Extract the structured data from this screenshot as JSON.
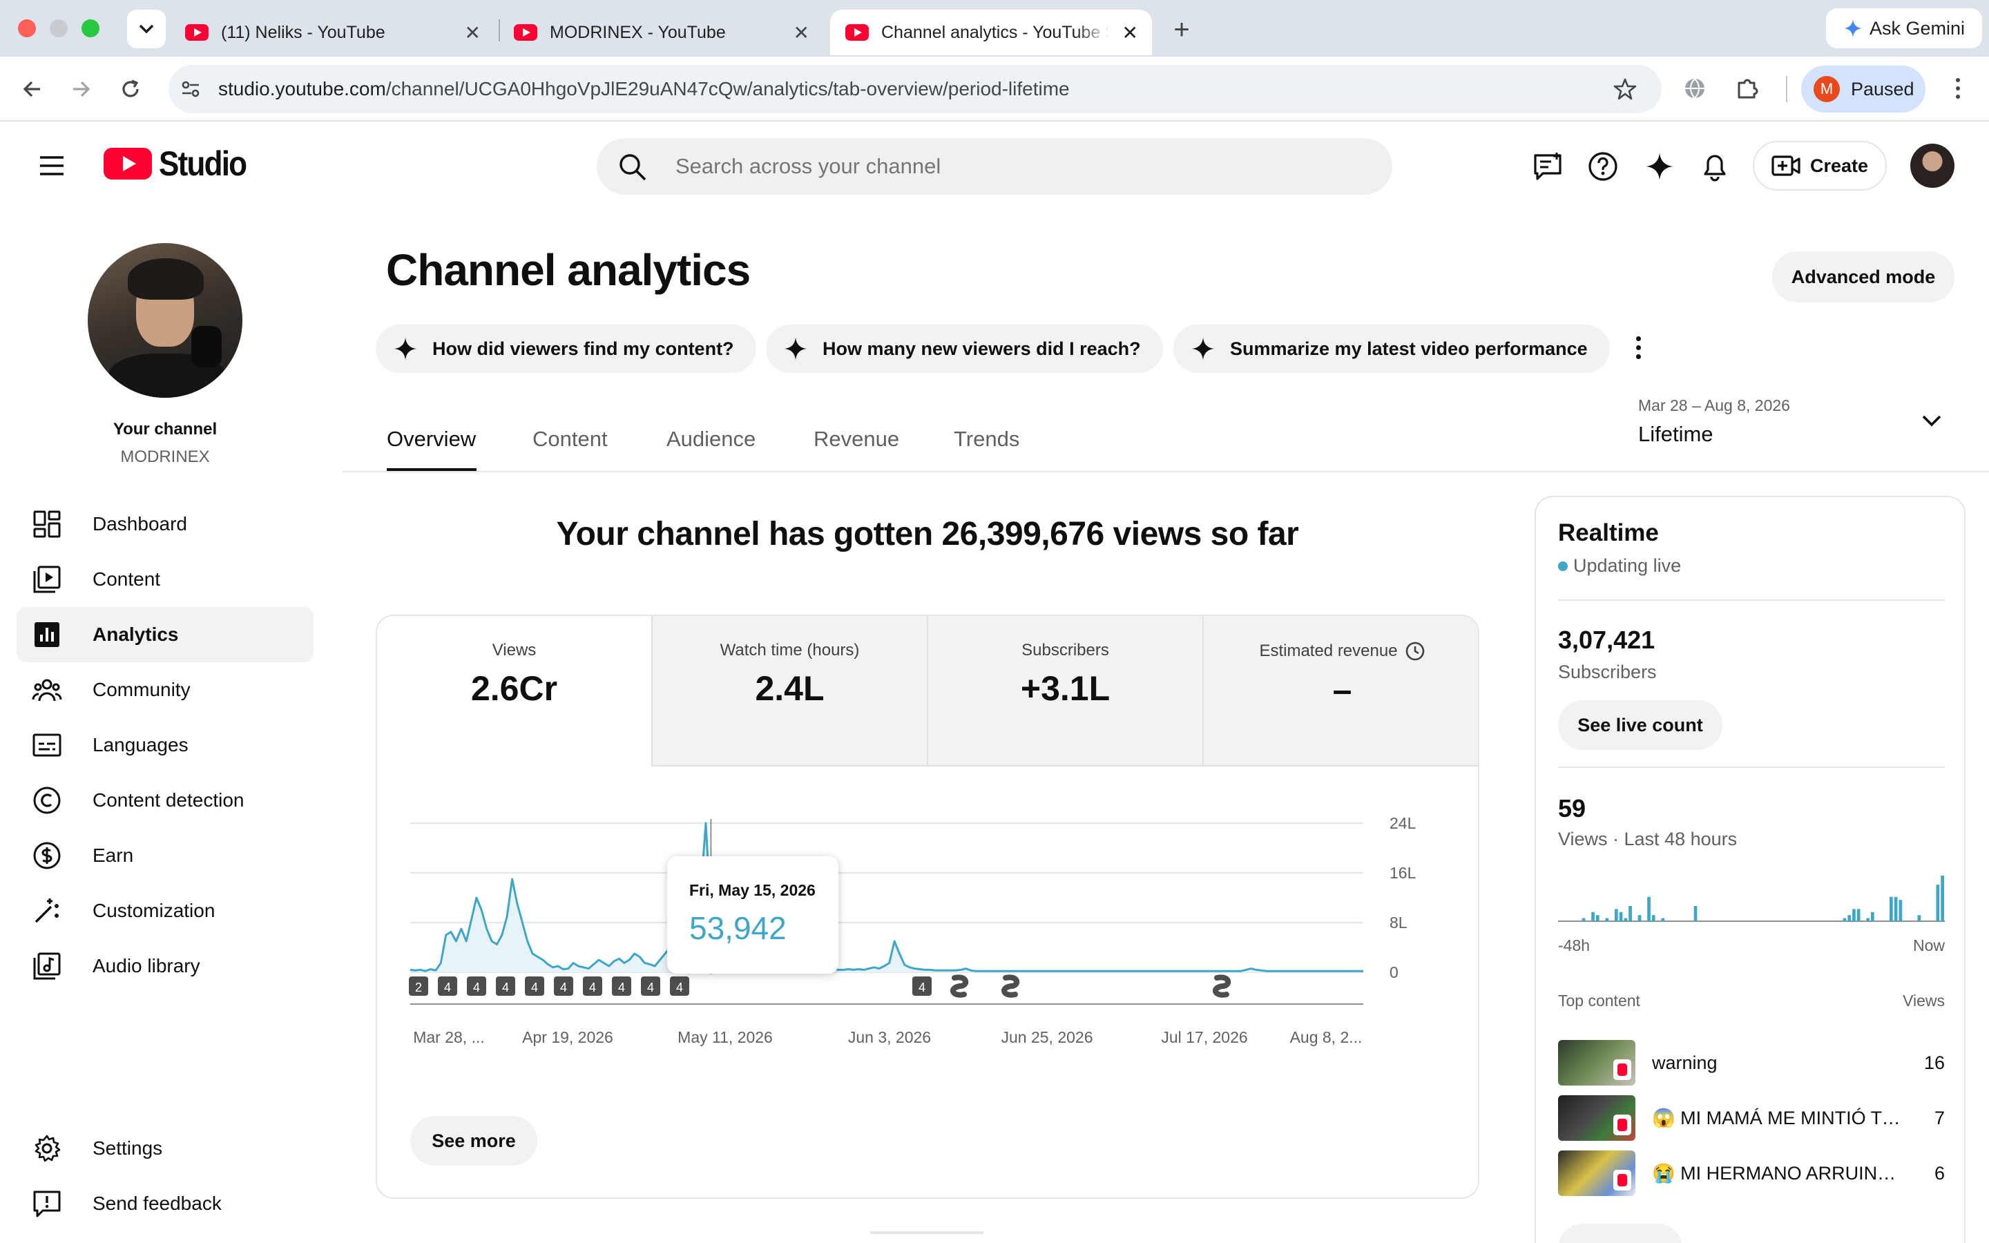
{
  "browser": {
    "tabs": [
      {
        "title": "(11) Neliks - YouTube"
      },
      {
        "title": "MODRINEX - YouTube"
      },
      {
        "title": "Channel analytics - YouTube Studio"
      }
    ],
    "url_domain": "studio.youtube.com",
    "url_path": "/channel/UCGA0HhgoVpJlE29uAN47cQw/analytics/tab-overview/period-lifetime",
    "profile_initial": "M",
    "profile_status": "Paused",
    "ask_gemini": "Ask Gemini"
  },
  "header": {
    "logo_text": "Studio",
    "search_placeholder": "Search across your channel",
    "create_label": "Create"
  },
  "sidebar": {
    "your_channel": "Your channel",
    "channel_name": "MODRINEX",
    "items": [
      {
        "label": "Dashboard",
        "icon": "dashboard-icon"
      },
      {
        "label": "Content",
        "icon": "content-icon"
      },
      {
        "label": "Analytics",
        "icon": "analytics-icon"
      },
      {
        "label": "Community",
        "icon": "community-icon"
      },
      {
        "label": "Languages",
        "icon": "languages-icon"
      },
      {
        "label": "Content detection",
        "icon": "copyright-icon"
      },
      {
        "label": "Earn",
        "icon": "earn-icon"
      },
      {
        "label": "Customization",
        "icon": "magic-wand-icon"
      },
      {
        "label": "Audio library",
        "icon": "audio-library-icon"
      }
    ],
    "settings": "Settings",
    "send_feedback": "Send feedback"
  },
  "page": {
    "title": "Channel analytics",
    "advanced_mode": "Advanced mode",
    "chips": [
      "How did viewers find my content?",
      "How many new viewers did I reach?",
      "Summarize my latest video performance"
    ],
    "tabs": [
      "Overview",
      "Content",
      "Audience",
      "Revenue",
      "Trends"
    ],
    "date_range": "Mar 28 – Aug 8, 2026",
    "period": "Lifetime",
    "headline": "Your channel has gotten 26,399,676 views so far"
  },
  "metrics": [
    {
      "label": "Views",
      "value": "2.6Cr"
    },
    {
      "label": "Watch time (hours)",
      "value": "2.4L"
    },
    {
      "label": "Subscribers",
      "value": "+3.1L"
    },
    {
      "label": "Estimated revenue",
      "value": "–"
    }
  ],
  "chart_data": {
    "type": "area",
    "y_tick_labels": [
      "24L",
      "16L",
      "8L",
      "0"
    ],
    "x_tick_labels": [
      "Mar 28, ...",
      "Apr 19, 2026",
      "May 11, 2026",
      "Jun 3, 2026",
      "Jun 25, 2026",
      "Jul 17, 2026",
      "Aug 8, 2..."
    ],
    "series": [
      {
        "values_lakh": [
          0.4,
          0.3,
          0.4,
          0.2,
          0.5,
          0.3,
          1.5,
          6,
          6.5,
          5,
          7,
          5,
          8.5,
          12,
          10,
          7,
          5,
          4.5,
          6,
          9,
          15,
          11,
          8,
          5,
          3,
          2.5,
          2,
          1.3,
          0.8,
          1,
          0.5,
          0.6,
          1.5,
          1,
          0.8,
          0.6,
          1.3,
          2,
          1.5,
          1,
          1.8,
          2.2,
          1.5,
          2,
          3,
          2.5,
          1.5,
          1.3,
          1,
          2,
          3,
          4,
          5,
          4.5,
          5,
          7,
          8,
          13,
          24,
          9,
          6,
          3,
          2,
          1,
          0.8,
          0.8,
          1,
          0.5,
          0.5,
          0.6,
          0.5,
          0.4,
          0.4,
          0.4,
          0.5,
          0.4,
          0.4,
          0.5,
          0.6,
          0.4,
          0.4,
          0.4,
          0.4,
          0.5,
          0.4,
          0.4,
          0.5,
          0.4,
          0.5,
          0.4,
          0.6,
          0.8,
          0.6,
          1,
          1.5,
          5,
          3,
          1.2,
          0.8,
          0.6,
          0.5,
          0.4,
          0.4,
          0.3,
          0.3,
          0.3,
          0.3,
          0.3,
          0.4,
          0.6,
          0.3,
          0.2,
          0.2,
          0.2,
          0.2,
          0.2,
          0.2,
          0.2,
          0.2,
          0.2,
          0.2,
          0.2,
          0.2,
          0.2,
          0.2,
          0.2,
          0.2,
          0.2,
          0.2,
          0.2,
          0.2,
          0.2,
          0.2,
          0.2,
          0.2,
          0.2,
          0.2,
          0.2,
          0.2,
          0.2,
          0.2,
          0.2,
          0.2,
          0.2,
          0.2,
          0.2,
          0.2,
          0.2,
          0.2,
          0.2,
          0.2,
          0.2,
          0.2,
          0.2,
          0.2,
          0.2,
          0.2,
          0.2,
          0.2,
          0.2,
          0.2,
          0.2,
          0.2,
          0.2,
          0.4,
          0.6,
          0.4,
          0.3,
          0.2,
          0.2,
          0.2,
          0.2,
          0.2,
          0.2,
          0.2,
          0.2,
          0.2,
          0.2,
          0.2,
          0.2,
          0.2,
          0.2,
          0.2,
          0.2,
          0.2,
          0.2,
          0.2,
          0.2
        ]
      }
    ],
    "ylim_lakh": [
      0,
      24
    ],
    "tooltip": {
      "date": "Fri, May 15, 2026",
      "value": "53,942"
    },
    "publish_markers": [
      "2",
      "4",
      "4",
      "4",
      "4",
      "4",
      "4",
      "4",
      "4",
      "4",
      "4"
    ],
    "see_more": "See more"
  },
  "realtime": {
    "title": "Realtime",
    "status": "Updating live",
    "subscribers_value": "3,07,421",
    "subscribers_label": "Subscribers",
    "see_live_count": "See live count",
    "views_value": "59",
    "views_label": "Views · Last 48 hours",
    "bars": [
      0,
      0,
      0,
      0,
      0,
      1,
      0,
      3,
      2,
      0,
      1,
      0,
      4,
      3,
      1,
      5,
      0,
      2,
      0,
      8,
      2,
      0,
      1,
      0,
      0,
      0,
      0,
      0,
      0,
      5,
      0,
      0,
      0,
      0,
      0,
      0,
      0,
      0,
      0,
      0,
      0,
      0,
      0,
      0,
      0,
      0,
      0,
      0,
      0,
      0,
      0,
      0,
      0,
      0,
      0,
      0,
      0,
      0,
      0,
      0,
      0,
      1,
      2,
      4,
      4,
      0,
      1,
      3,
      0,
      0,
      0,
      8,
      8,
      7,
      0,
      0,
      0,
      2,
      0,
      0,
      0,
      12,
      15
    ],
    "start_label": "-48h",
    "end_label": "Now",
    "top_content_label": "Top content",
    "top_content_views_label": "Views",
    "top_content": [
      {
        "title": "warning",
        "views": "16"
      },
      {
        "title": "😱 MI MAMÁ ME MINTIÓ TODA MI VIDA",
        "views": "7"
      },
      {
        "title": "😭 MI HERMANO ARRUINÓ MI CUMPLEAÑOS",
        "views": "6"
      }
    ]
  },
  "colors": {
    "accent": "#3ea6c8",
    "youtube_red": "#ff0033"
  }
}
